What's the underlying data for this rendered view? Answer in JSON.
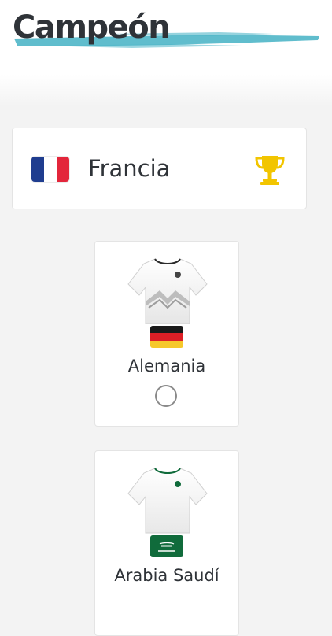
{
  "header": {
    "title": "Campeón"
  },
  "champion": {
    "name": "Francia",
    "flag_colors": [
      "#1f3d8f",
      "#ffffff",
      "#e3263b"
    ],
    "icon": "trophy-icon",
    "icon_color": "#f2c500"
  },
  "teams": [
    {
      "name": "Alemania",
      "flag_colors": [
        "#1a1a1a",
        "#dd1f26",
        "#f6c82b"
      ],
      "jersey": "white-black",
      "selected": false
    },
    {
      "name": "Arabia Saudí",
      "flag_colors": [
        "#106b3b"
      ],
      "jersey": "white-green",
      "selected": false
    }
  ],
  "colors": {
    "accent_brush": "#4fb6c8",
    "text": "#2f3338",
    "background": "#f3f3f3"
  }
}
